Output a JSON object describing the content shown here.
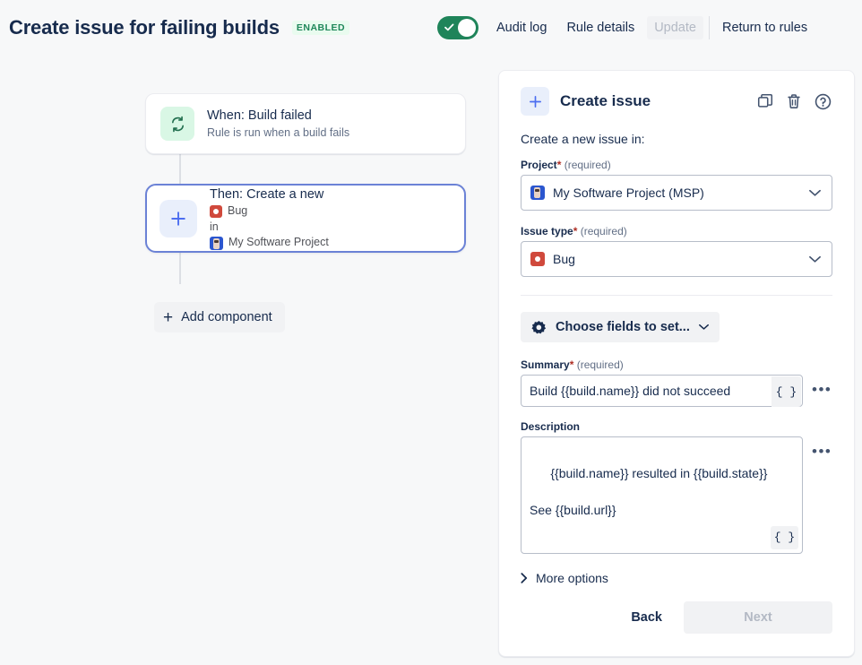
{
  "header": {
    "title": "Create issue for failing builds",
    "status_badge": "ENABLED",
    "toggle_on": true,
    "audit_log": "Audit log",
    "rule_details": "Rule details",
    "update": "Update",
    "return_to_rules": "Return to rules",
    "accent_green": "#1f845a",
    "badge_bg": "#e9fbef",
    "badge_fg": "#1f875a"
  },
  "canvas": {
    "trigger": {
      "title": "When: Build failed",
      "subtitle": "Rule is run when a build fails",
      "icon_bg": "#d9f7e5"
    },
    "action": {
      "title": "Then: Create a new",
      "issue_type": "Bug",
      "connector_word": "in",
      "project": "My Software Project",
      "selected": true,
      "selected_border": "#6b82d6"
    },
    "add_component": "Add component"
  },
  "panel": {
    "title": "Create issue",
    "icons": [
      "duplicate-icon",
      "trash-icon",
      "help-icon"
    ],
    "subhead": "Create a new issue in:",
    "project_field": {
      "label": "Project",
      "star": "*",
      "required": "(required)",
      "value": "My Software Project (MSP)"
    },
    "issue_type_field": {
      "label": "Issue type",
      "star": "*",
      "required": "(required)",
      "value": "Bug"
    },
    "choose_fields": "Choose fields to set...",
    "summary_field": {
      "label": "Summary",
      "star": "*",
      "required": "(required)",
      "value": "Build {{build.name}} did not succeed",
      "smart_value_btn": "{ }",
      "more_btn": "•••"
    },
    "description_field": {
      "label": "Description",
      "value": "{{build.name}} resulted in {{build.state}}\n\nSee {{build.url}}",
      "smart_value_btn": "{ }",
      "more_btn": "•••"
    },
    "more_options": "More options",
    "back": "Back",
    "next": "Next",
    "next_disabled": true
  }
}
